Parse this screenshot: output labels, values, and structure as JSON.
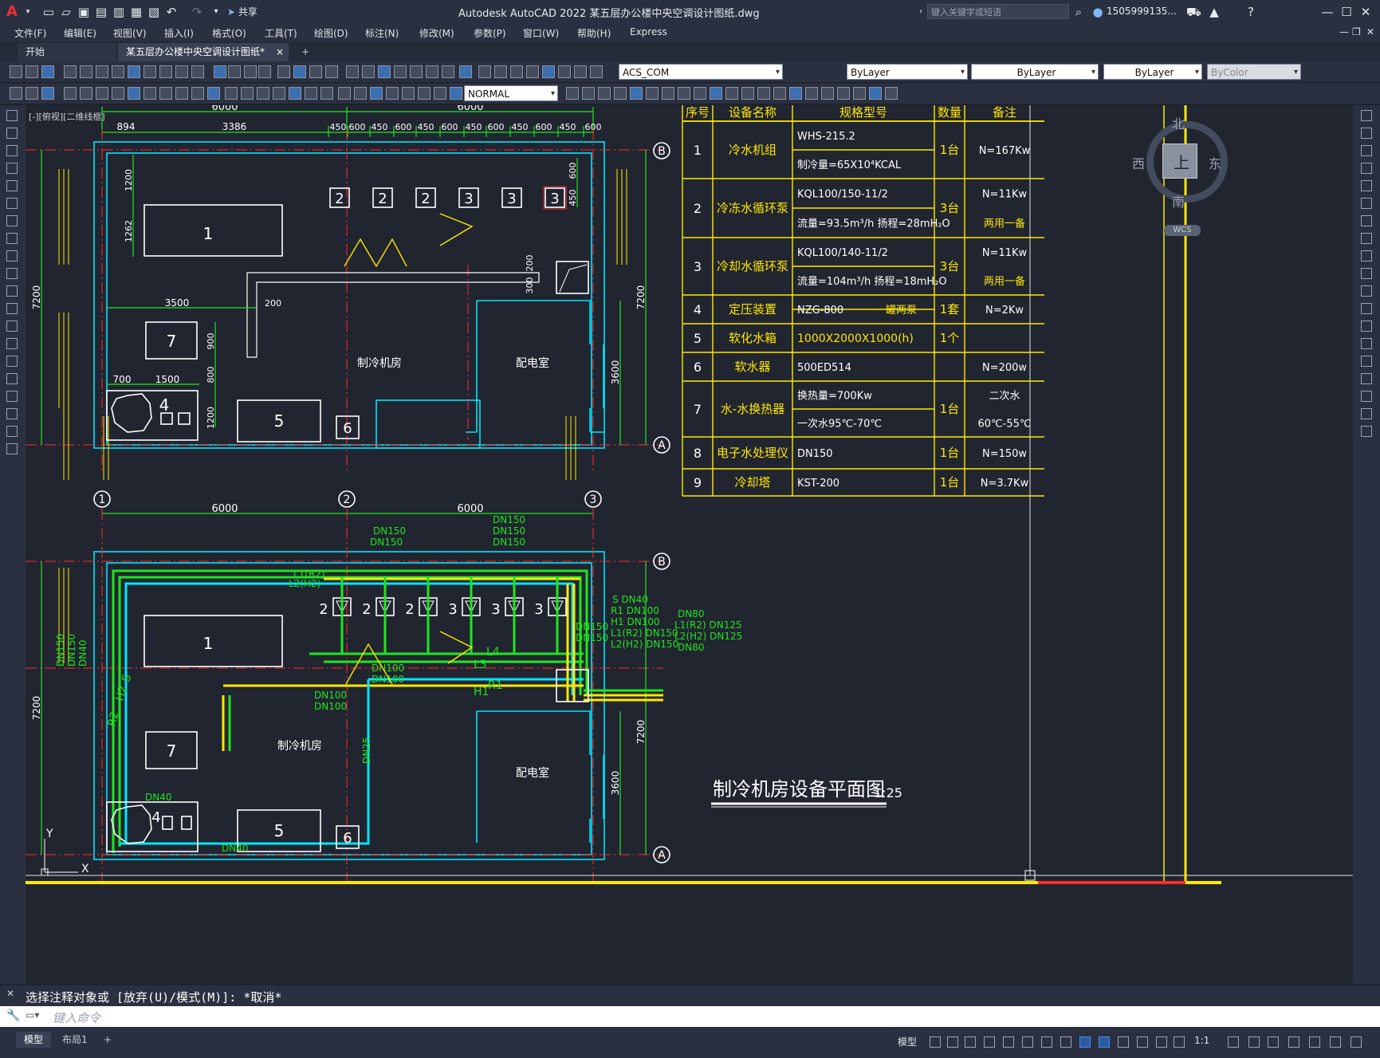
{
  "titlebar": {
    "app_logo": "A",
    "share_label": "共享",
    "title": "Autodesk AutoCAD 2022    某五层办公楼中央空调设计图纸.dwg",
    "search_placeholder": "键入关键字或短语",
    "user": "1505999135...",
    "icons": [
      "new-icon",
      "open-icon",
      "save-icon",
      "saveas-icon",
      "web-icon",
      "plot-icon",
      "undo-icon",
      "redo-icon",
      "share-icon",
      "search-icon",
      "user-icon",
      "cart-icon",
      "help-icon",
      "minimize-icon",
      "maximize-icon",
      "close-icon"
    ]
  },
  "menubar": {
    "items": [
      "文件(F)",
      "编辑(E)",
      "视图(V)",
      "插入(I)",
      "格式(O)",
      "工具(T)",
      "绘图(D)",
      "标注(N)",
      "修改(M)",
      "参数(P)",
      "窗口(W)",
      "帮助(H)",
      "Express"
    ]
  },
  "tabs": {
    "start": "开始",
    "active": "某五层办公楼中央空调设计图纸*",
    "close_glyph": "×",
    "add_glyph": "+"
  },
  "toolbar1": {
    "layer_value": "ACS_COM",
    "color_value": "ByLayer",
    "linetype_value": "ByLayer",
    "lineweight_value": "ByLayer",
    "plotstyle_value": "ByColor"
  },
  "toolbar2": {
    "style_value": "NORMAL"
  },
  "viewport": {
    "label": "[-][俯视][二维线框]"
  },
  "viewcube": {
    "north": "北",
    "south": "南",
    "east": "东",
    "west": "西",
    "face": "上",
    "wcs": "WCS"
  },
  "drawing": {
    "top_dims": {
      "span1": "6000",
      "span2": "6000",
      "d894": "894",
      "d3386": "3386",
      "pitches": [
        "450",
        "600",
        "450",
        "600",
        "450",
        "600",
        "450",
        "600",
        "450",
        "600",
        "450",
        "600"
      ],
      "d1200a": "1200",
      "d1262": "1262",
      "d3500": "3500",
      "d200a": "200",
      "d200b": "200",
      "d300": "300",
      "d900": "900",
      "d800a": "800",
      "d1200b": "1200",
      "d700": "700",
      "d1500": "1500",
      "d800b": "800",
      "d450": "450",
      "left7200": "7200",
      "right7200": "7200",
      "right3600": "3600"
    },
    "axes": {
      "a": "A",
      "b": "B",
      "n1": "1",
      "n2": "2",
      "n3": "3"
    },
    "equip_labels": [
      "1",
      "2",
      "2",
      "2",
      "3",
      "3",
      "3",
      "4",
      "5",
      "6",
      "7"
    ],
    "rooms": {
      "chiller_room": "制冷机房",
      "power_room": "配电室"
    },
    "bottom_dims": {
      "span1": "6000",
      "span2": "6000",
      "left7200": "7200",
      "right7200": "7200",
      "right3600": "3600"
    },
    "pipe_labels": {
      "dn150_a": "DN150",
      "dn150_b": "DN150",
      "dn150_c": "DN150",
      "dn150_d": "DN150",
      "dn150_e": "DN150",
      "l1r2": "L1(R2)",
      "l2h2": "L2(H2)",
      "s_dn40": "S DN40",
      "r1_dn100": "R1 DN100",
      "h1_dn100": "H1 DN100",
      "l1r2_dn150": "L1(R2) DN150",
      "l2h2_dn150": "L2(H2) DN150",
      "dn80a": "DN80",
      "l1r2_dn125": "L1(R2) DN125",
      "l2h2_dn125": "L2(H2) DN125",
      "dn80b": "DN80",
      "l4": "L4",
      "l3": "L3",
      "r1": "R1",
      "h1": "H1",
      "dn100_a": "DN100",
      "dn100_b": "DN100",
      "dn100_c": "DN100",
      "dn100_d": "DN100",
      "dn150_f": "DN150",
      "dn150_g": "DN150",
      "dn25": "DN25",
      "dn40": "DN40",
      "dn40_b": "DN40",
      "vert_left": [
        "DN150",
        "DN150",
        "DN40"
      ],
      "r2": "R2",
      "h2": "H2",
      "s": "S"
    },
    "plan_title": "制冷机房设备平面图",
    "plan_scale": "1:25",
    "y_marker": "Y",
    "x_marker": "X"
  },
  "equipment_table": {
    "headers": [
      "序号",
      "设备名称",
      "规格型号",
      "数量",
      "备注"
    ],
    "rows": [
      {
        "no": "1",
        "name": "冷水机组",
        "spec": [
          "WHS-215.2",
          "制冷量=65X10⁴KCAL"
        ],
        "qty": "1台",
        "note": [
          "N=167Kw"
        ]
      },
      {
        "no": "2",
        "name": "冷冻水循环泵",
        "spec": [
          "KQL100/150-11/2",
          "流量=93.5m³/h  扬程=28mH₂O"
        ],
        "qty": "3台",
        "note": [
          "N=11Kw",
          "两用一备"
        ]
      },
      {
        "no": "3",
        "name": "冷却水循环泵",
        "spec": [
          "KQL100/140-11/2",
          "流量=104m³/h  扬程=18mH₂O"
        ],
        "qty": "3台",
        "note": [
          "N=11Kw",
          "两用一备"
        ]
      },
      {
        "no": "4",
        "name": "定压装置",
        "spec": [
          "NZG-800",
          "一罐两泵"
        ],
        "qty": "1套",
        "note": [
          "N=2Kw"
        ]
      },
      {
        "no": "5",
        "name": "软化水箱",
        "spec": [
          "1000X2000X1000(h)"
        ],
        "qty": "1个",
        "note": [
          ""
        ]
      },
      {
        "no": "6",
        "name": "软水器",
        "spec": [
          "500ED514"
        ],
        "qty": "",
        "note": [
          "N=200w"
        ]
      },
      {
        "no": "7",
        "name": "水-水换热器",
        "spec": [
          "换热量=700Kw",
          "一次水95℃-70℃"
        ],
        "qty": "1台",
        "note": [
          "二次水",
          "60℃-55℃"
        ]
      },
      {
        "no": "8",
        "name": "电子水处理仪",
        "spec": [
          "DN150"
        ],
        "qty": "1台",
        "note": [
          "N=150w"
        ]
      },
      {
        "no": "9",
        "name": "冷却塔",
        "spec": [
          "KST-200"
        ],
        "qty": "1台",
        "note": [
          "N=3.7Kw"
        ]
      }
    ]
  },
  "command": {
    "history": "选择注释对象或 [放弃(U)/模式(M)]: *取消*",
    "placeholder": "键入命令"
  },
  "statusbar": {
    "model_tab": "模型",
    "layout_tab": "布局1",
    "add_glyph": "+",
    "model_label": "模型",
    "scale": "1:1"
  },
  "colors": {
    "cyan": "#00e5ff",
    "green": "#1ee51e",
    "yellow": "#ffe800",
    "red": "#ff2a2a",
    "white": "#ffffff",
    "canvas": "#212530"
  }
}
